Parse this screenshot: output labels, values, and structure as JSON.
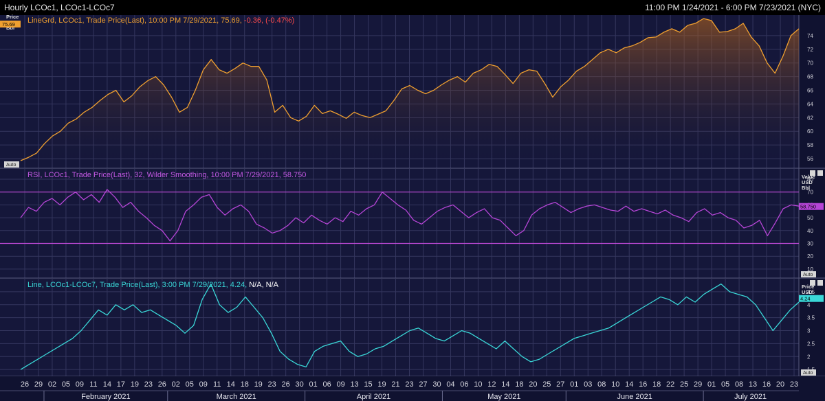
{
  "header": {
    "title": "Hourly LCOc1, LCOc1-LCOc7",
    "range": "11:00 PM 1/24/2021 - 6:00 PM 7/23/2021 (NYC)"
  },
  "colors": {
    "background": "#15173a",
    "grid": "#34365e",
    "price_line": "#f0a030",
    "rsi_line": "#b545d6",
    "spread_line": "#3ad8d8",
    "negative": "#ff4a4a",
    "auto_badge": "#d6d6d6"
  },
  "x_axis": {
    "day_ticks": [
      "26",
      "29",
      "02",
      "05",
      "09",
      "11",
      "14",
      "17",
      "19",
      "23",
      "26",
      "02",
      "05",
      "09",
      "11",
      "14",
      "18",
      "19",
      "23",
      "26",
      "30",
      "01",
      "06",
      "09",
      "13",
      "15",
      "19",
      "21",
      "23",
      "27",
      "30",
      "04",
      "06",
      "10",
      "12",
      "14",
      "18",
      "20",
      "25",
      "27",
      "01",
      "03",
      "08",
      "10",
      "14",
      "16",
      "18",
      "22",
      "25",
      "29",
      "01",
      "05",
      "08",
      "13",
      "16",
      "20",
      "23"
    ],
    "months": [
      "February 2021",
      "March 2021",
      "April 2021",
      "May 2021",
      "June 2021",
      "July 2021"
    ]
  },
  "chart_data": [
    {
      "type": "line",
      "panel": "price",
      "legend": {
        "text": "LineGrd, LCOc1, Trade Price(Last), 10:00 PM 7/29/2021, 75.69, ",
        "change": "-0.36, (-0.47%)"
      },
      "y_unit": [
        "Price",
        "USD",
        "Bbl"
      ],
      "y_ticks": [
        56,
        58,
        60,
        62,
        64,
        66,
        68,
        70,
        72,
        74
      ],
      "ylim": [
        54.6,
        77.0
      ],
      "last_value": "75.69",
      "auto_label": "Auto",
      "series": [
        {
          "values": [
            55.7,
            56.2,
            56.8,
            58.2,
            59.3,
            60.0,
            61.2,
            61.8,
            62.8,
            63.5,
            64.5,
            65.4,
            66.0,
            64.3,
            65.2,
            66.5,
            67.4,
            68.0,
            66.8,
            65.0,
            62.8,
            63.5,
            66.0,
            69.0,
            70.5,
            69.0,
            68.5,
            69.2,
            70.0,
            69.5,
            69.5,
            67.5,
            62.8,
            63.8,
            62.0,
            61.5,
            62.2,
            63.8,
            62.6,
            63.0,
            62.5,
            61.9,
            62.8,
            62.3,
            62.0,
            62.5,
            63.0,
            64.5,
            66.2,
            66.7,
            66.0,
            65.5,
            66.0,
            66.8,
            67.5,
            68.0,
            67.2,
            68.5,
            69.0,
            69.8,
            69.5,
            68.3,
            67.0,
            68.5,
            69.0,
            68.8,
            67.0,
            65.0,
            66.5,
            67.5,
            68.8,
            69.5,
            70.5,
            71.5,
            72.0,
            71.5,
            72.2,
            72.5,
            73.0,
            73.7,
            73.8,
            74.5,
            75.0,
            74.5,
            75.5,
            75.8,
            76.5,
            76.2,
            74.5,
            74.6,
            75.0,
            75.8,
            73.8,
            72.5,
            70.0,
            68.5,
            71.0,
            74.0,
            75.0
          ]
        }
      ]
    },
    {
      "type": "line",
      "panel": "rsi",
      "legend": {
        "text": "RSI, LCOc1, Trade Price(Last),  32, Wilder Smoothing, 10:00 PM 7/29/2021, 58.750"
      },
      "y_unit": [
        "Value",
        "USD",
        "Bbl"
      ],
      "y_ticks": [
        10,
        20,
        30,
        40,
        50,
        60,
        70,
        80
      ],
      "ylim": [
        3.0,
        88.0
      ],
      "bands": [
        30,
        70
      ],
      "last_value": "58.750",
      "auto_label": "Auto",
      "series": [
        {
          "values": [
            50,
            58,
            55,
            62,
            65,
            60,
            66,
            70,
            64,
            68,
            62,
            72,
            66,
            58,
            62,
            55,
            50,
            44,
            40,
            32,
            40,
            55,
            60,
            66,
            68,
            58,
            52,
            57,
            60,
            55,
            45,
            42,
            38,
            40,
            44,
            50,
            46,
            52,
            48,
            45,
            50,
            47,
            55,
            52,
            57,
            60,
            70,
            65,
            60,
            56,
            48,
            45,
            50,
            55,
            58,
            60,
            55,
            50,
            54,
            57,
            50,
            48,
            42,
            36,
            40,
            52,
            57,
            60,
            62,
            58,
            54,
            57,
            59,
            60,
            58,
            56,
            55,
            59,
            55,
            57,
            55,
            53,
            56,
            52,
            50,
            47,
            54,
            57,
            52,
            54,
            50,
            48,
            42,
            44,
            48,
            36,
            46,
            57,
            60,
            59
          ]
        }
      ]
    },
    {
      "type": "line",
      "panel": "spread",
      "legend": {
        "text": "Line, LCOc1-LCOc7, Trade Price(Last), 3:00 PM 7/29/2021, 4.24, ",
        "na": "N/A, N/A"
      },
      "y_unit": [
        "Price",
        "USD",
        "Bbl"
      ],
      "y_ticks": [
        1.5,
        2,
        2.5,
        3,
        3.5,
        4,
        4.5
      ],
      "ylim": [
        1.24,
        5.0
      ],
      "last_value": "4.24",
      "auto_label": "Auto",
      "series": [
        {
          "values": [
            1.5,
            1.7,
            1.9,
            2.1,
            2.3,
            2.5,
            2.7,
            3.0,
            3.4,
            3.8,
            3.6,
            4.0,
            3.8,
            4.0,
            3.7,
            3.8,
            3.6,
            3.4,
            3.2,
            2.9,
            3.2,
            4.2,
            4.8,
            4.0,
            3.7,
            3.9,
            4.3,
            3.9,
            3.5,
            2.9,
            2.2,
            1.9,
            1.7,
            1.6,
            2.2,
            2.4,
            2.5,
            2.6,
            2.2,
            2.0,
            2.1,
            2.3,
            2.4,
            2.6,
            2.8,
            3.0,
            3.1,
            2.9,
            2.7,
            2.6,
            2.8,
            3.0,
            2.9,
            2.7,
            2.5,
            2.3,
            2.6,
            2.3,
            2.0,
            1.8,
            1.9,
            2.1,
            2.3,
            2.5,
            2.7,
            2.8,
            2.9,
            3.0,
            3.1,
            3.3,
            3.5,
            3.7,
            3.9,
            4.1,
            4.3,
            4.2,
            4.0,
            4.3,
            4.1,
            4.4,
            4.6,
            4.8,
            4.5,
            4.4,
            4.3,
            4.0,
            3.5,
            3.0,
            3.4,
            3.8,
            4.1
          ]
        }
      ]
    }
  ]
}
